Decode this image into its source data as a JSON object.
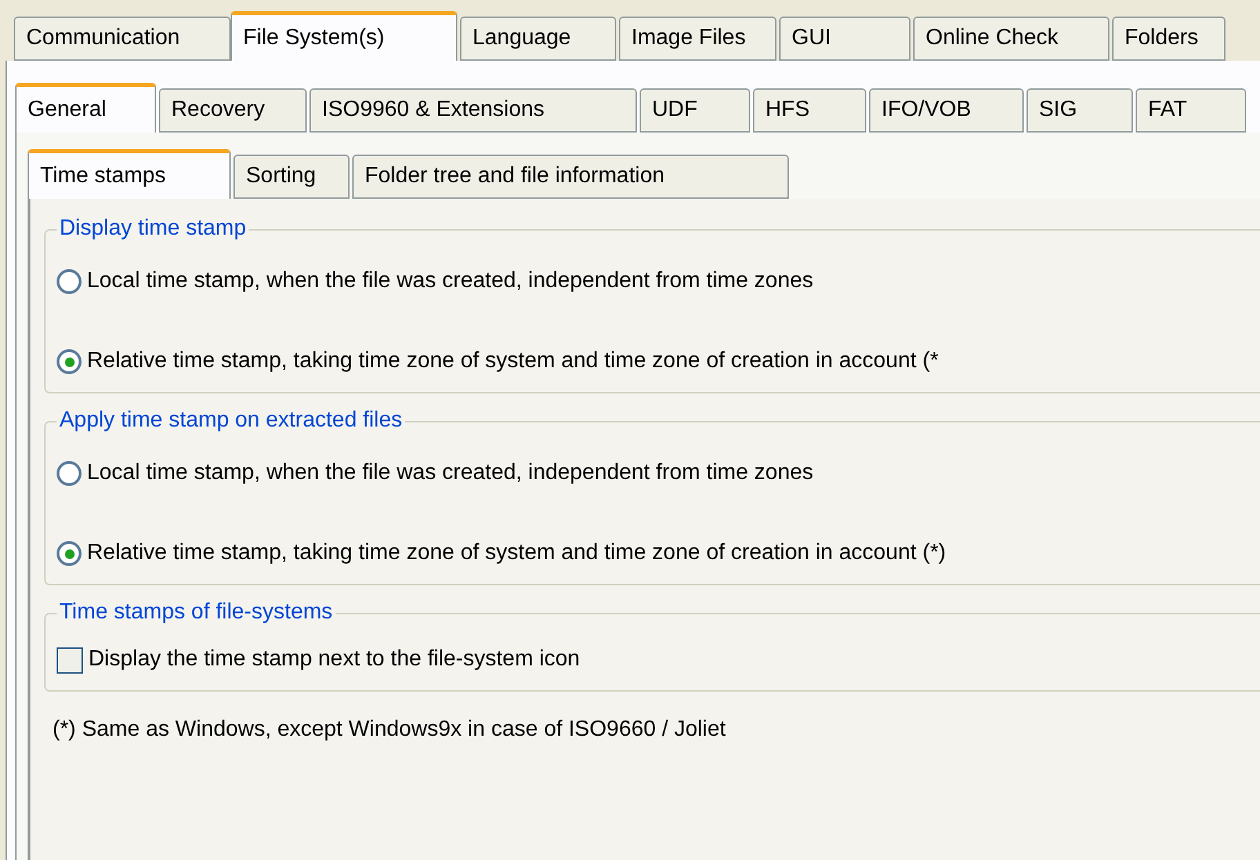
{
  "main_tabs": [
    {
      "label": "Communication",
      "selected": false
    },
    {
      "label": "File System(s)",
      "selected": true
    },
    {
      "label": "Language",
      "selected": false
    },
    {
      "label": "Image Files",
      "selected": false
    },
    {
      "label": "GUI",
      "selected": false
    },
    {
      "label": "Online Check",
      "selected": false
    },
    {
      "label": "Folders",
      "selected": false
    }
  ],
  "sub_tabs": [
    {
      "label": "General",
      "selected": true
    },
    {
      "label": "Recovery",
      "selected": false
    },
    {
      "label": "ISO9960 & Extensions",
      "selected": false
    },
    {
      "label": "UDF",
      "selected": false
    },
    {
      "label": "HFS",
      "selected": false
    },
    {
      "label": "IFO/VOB",
      "selected": false
    },
    {
      "label": "SIG",
      "selected": false
    },
    {
      "label": "FAT",
      "selected": false
    }
  ],
  "inner_tabs": [
    {
      "label": "Time stamps",
      "selected": true
    },
    {
      "label": "Sorting",
      "selected": false
    },
    {
      "label": "Folder tree and file information",
      "selected": false
    }
  ],
  "groups": [
    {
      "title": "Display time stamp",
      "options": [
        {
          "kind": "radio",
          "label": "Local time stamp, when the file was created, independent from time zones",
          "selected": false
        },
        {
          "kind": "radio",
          "label": "Relative time stamp, taking time zone of system and time zone of creation in account (*",
          "selected": true
        }
      ]
    },
    {
      "title": "Apply time stamp on extracted files",
      "options": [
        {
          "kind": "radio",
          "label": "Local time stamp, when the file was created, independent from time zones",
          "selected": false
        },
        {
          "kind": "radio",
          "label": "Relative time stamp, taking time zone of system and time zone of creation in account (*)",
          "selected": true
        }
      ]
    },
    {
      "title": "Time stamps of file-systems",
      "options": [
        {
          "kind": "checkbox",
          "label": "Display the time stamp next to the file-system icon",
          "checked": false
        }
      ]
    }
  ],
  "footnote": "(*) Same as Windows, except Windows9x in case of ISO9660 / Joliet"
}
